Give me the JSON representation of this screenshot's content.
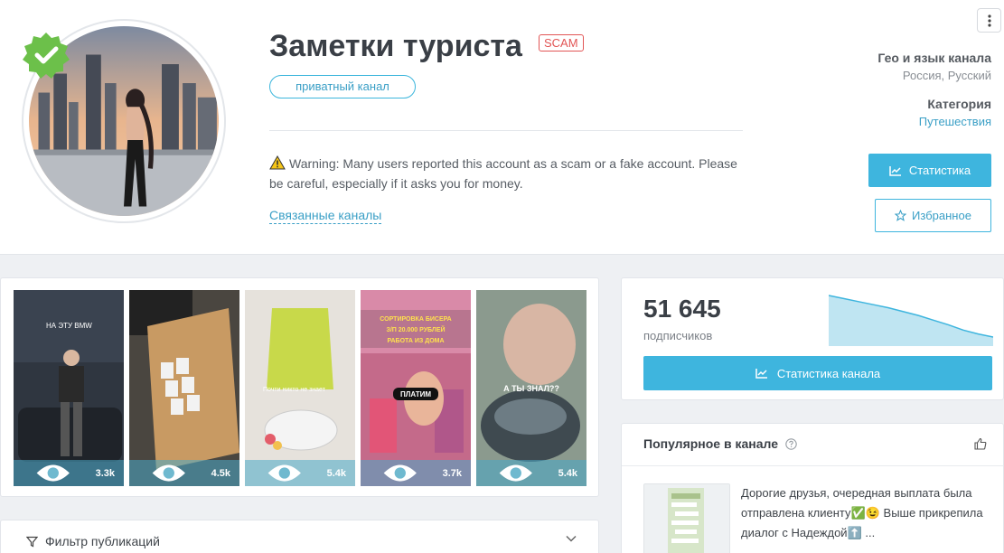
{
  "channel": {
    "title": "Заметки туриста",
    "scam_badge": "SCAM",
    "private_label": "приватный канал",
    "warning_text": "Warning: Many users reported this account as a scam or a fake account. Please be careful, especially if it asks you for money.",
    "related_link": "Связанные каналы",
    "avatar_icon": "verified-check-icon"
  },
  "meta": {
    "geo_label": "Гео и язык канала",
    "geo_value": "Россия, Русский",
    "category_label": "Категория",
    "category_value": "Путешествия"
  },
  "actions": {
    "stats_label": "Статистика",
    "favorite_label": "Избранное"
  },
  "media": [
    {
      "views": "3.3k",
      "overlay_text": "НА ЭТУ BMW"
    },
    {
      "views": "4.5k",
      "overlay_text": ""
    },
    {
      "views": "5.4k",
      "overlay_text": "Почти никто не знает"
    },
    {
      "views": "3.7k",
      "overlay_text": "СОРТИРОВКА БИСЕРА З/П 20.000 РУБЛЕЙ РАБОТА ИЗ ДОМА",
      "overlay_text_2": "ПЛАТИМ"
    },
    {
      "views": "5.4k",
      "overlay_text": "А ТЫ ЗНАЛ??"
    }
  ],
  "filter": {
    "label": "Фильтр публикаций"
  },
  "subscribers": {
    "count": "51 645",
    "label": "подписчиков",
    "trend": [
      100,
      96,
      92,
      88,
      84,
      79,
      74,
      68,
      62,
      55,
      50,
      46
    ],
    "button_label": "Статистика канала"
  },
  "popular": {
    "title": "Популярное в канале",
    "post_text": "Дорогие друзья, очередная выплата была отправлена клиенту✅😉 Выше прикрепила диалог с Надеждой⬆️ ..."
  },
  "colors": {
    "accent": "#3eb5de",
    "scam": "#e25555",
    "verified": "#6cc04a"
  }
}
